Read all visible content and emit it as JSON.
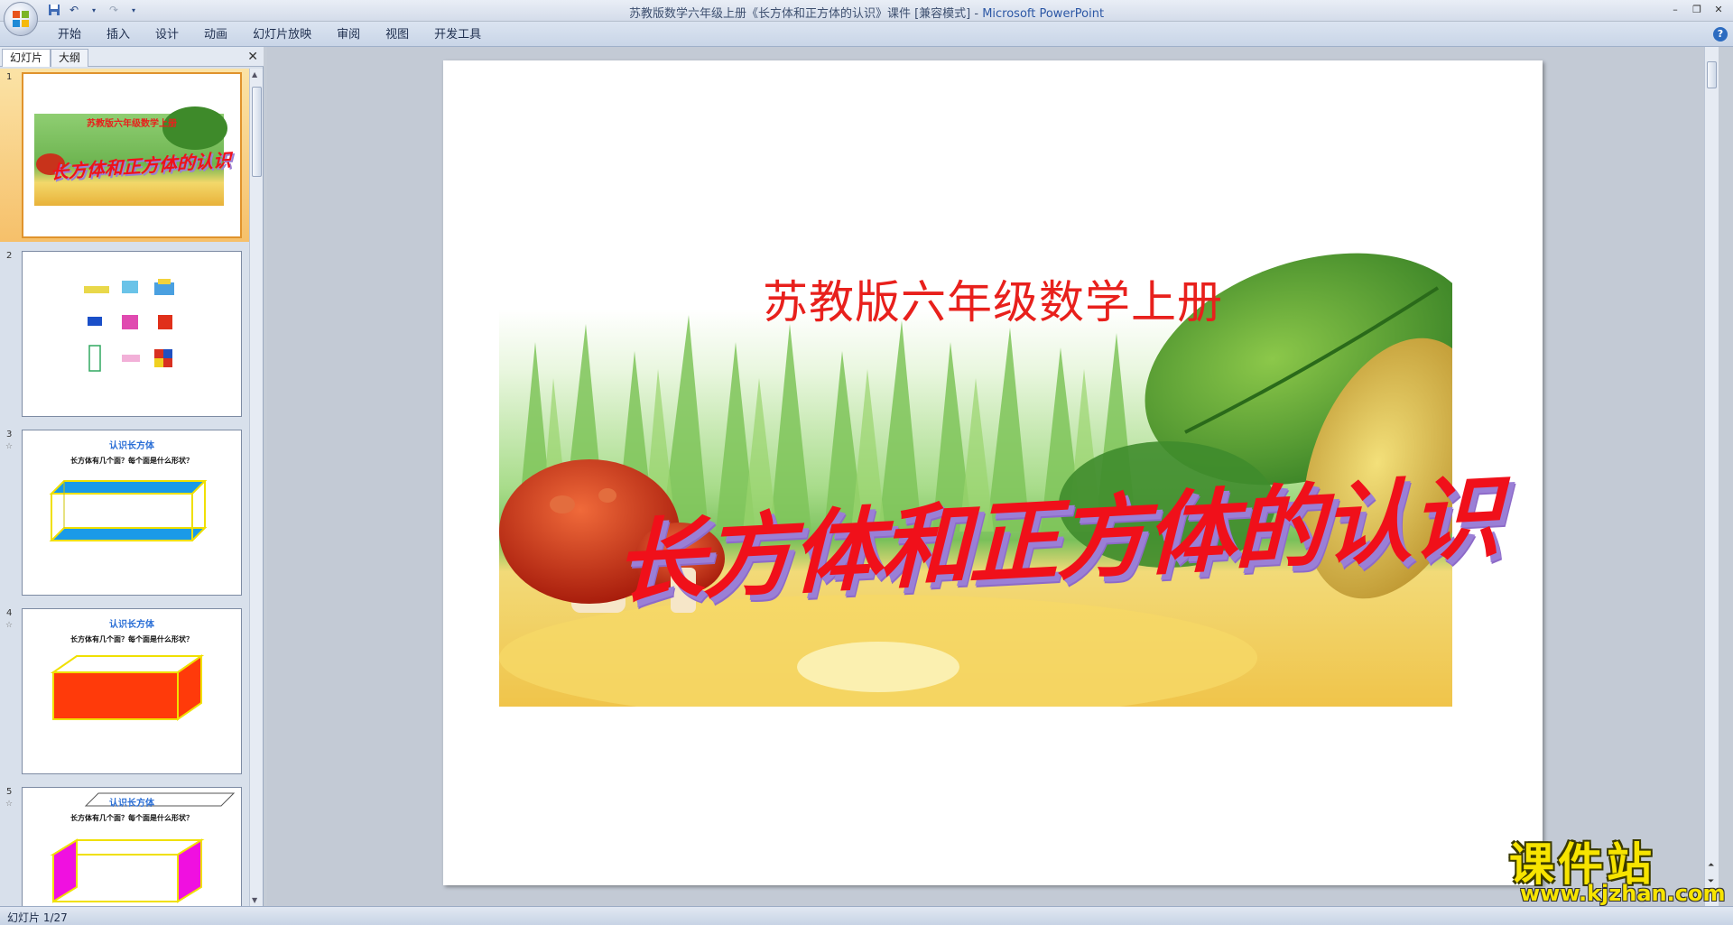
{
  "window": {
    "title": "苏教版数学六年级上册《长方体和正方体的认识》课件 [兼容模式]",
    "app_name": "Microsoft PowerPoint",
    "title_separator": " - "
  },
  "ribbon": {
    "tabs": [
      "开始",
      "插入",
      "设计",
      "动画",
      "幻灯片放映",
      "审阅",
      "视图",
      "开发工具"
    ]
  },
  "panel": {
    "tab_slides": "幻灯片",
    "tab_outline": "大纲"
  },
  "thumbnails": [
    {
      "num": "1",
      "subtitle": "苏教版六年级数学上册",
      "title": "长方体和正方体的认识"
    },
    {
      "num": "2"
    },
    {
      "num": "3",
      "heading": "认识长方体",
      "question": "长方体有几个面？每个面是什么形状？"
    },
    {
      "num": "4",
      "heading": "认识长方体",
      "question": "长方体有几个面？每个面是什么形状？"
    },
    {
      "num": "5",
      "heading": "认识长方体",
      "question": "长方体有几个面？每个面是什么形状？"
    }
  ],
  "slide": {
    "subtitle": "苏教版六年级数学上册",
    "title": "长方体和正方体的认识"
  },
  "watermark": {
    "big": "课件站",
    "small": "www.kjzhan.com"
  },
  "status": {
    "slide_indicator": "幻灯片 1/27"
  },
  "colors": {
    "title_red": "#f0101a",
    "accent_blue": "#2b6fd6",
    "selection_orange": "#f6c06a"
  }
}
